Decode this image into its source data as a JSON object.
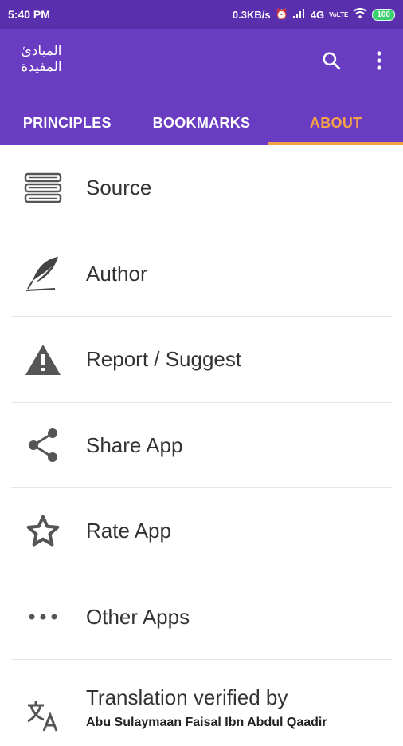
{
  "status_bar": {
    "time": "5:40 PM",
    "net_speed": "0.3KB/s",
    "network_type": "4G",
    "volte": "VoLTE",
    "battery": "100"
  },
  "app_bar": {
    "logo_text": "المبادئ المفيدة",
    "search_icon": "search-icon",
    "menu_icon": "more-vert-icon",
    "background_color": "#6a3cc2",
    "status_color": "#5a2fae"
  },
  "tabs": [
    {
      "label": "PRINCIPLES",
      "active": false
    },
    {
      "label": "BOOKMARKS",
      "active": false
    },
    {
      "label": "ABOUT",
      "active": true
    }
  ],
  "accent_color": "#f5a04a",
  "about_items": [
    {
      "icon": "books-icon",
      "label": "Source"
    },
    {
      "icon": "quill-icon",
      "label": "Author"
    },
    {
      "icon": "warning-icon",
      "label": "Report / Suggest"
    },
    {
      "icon": "share-icon",
      "label": "Share App"
    },
    {
      "icon": "star-icon",
      "label": "Rate App"
    },
    {
      "icon": "more-horiz-icon",
      "label": "Other Apps"
    },
    {
      "icon": "translate-icon",
      "label": "Translation verified by",
      "sub": "Abu Sulaymaan Faisal Ibn Abdul Qaadir"
    }
  ]
}
